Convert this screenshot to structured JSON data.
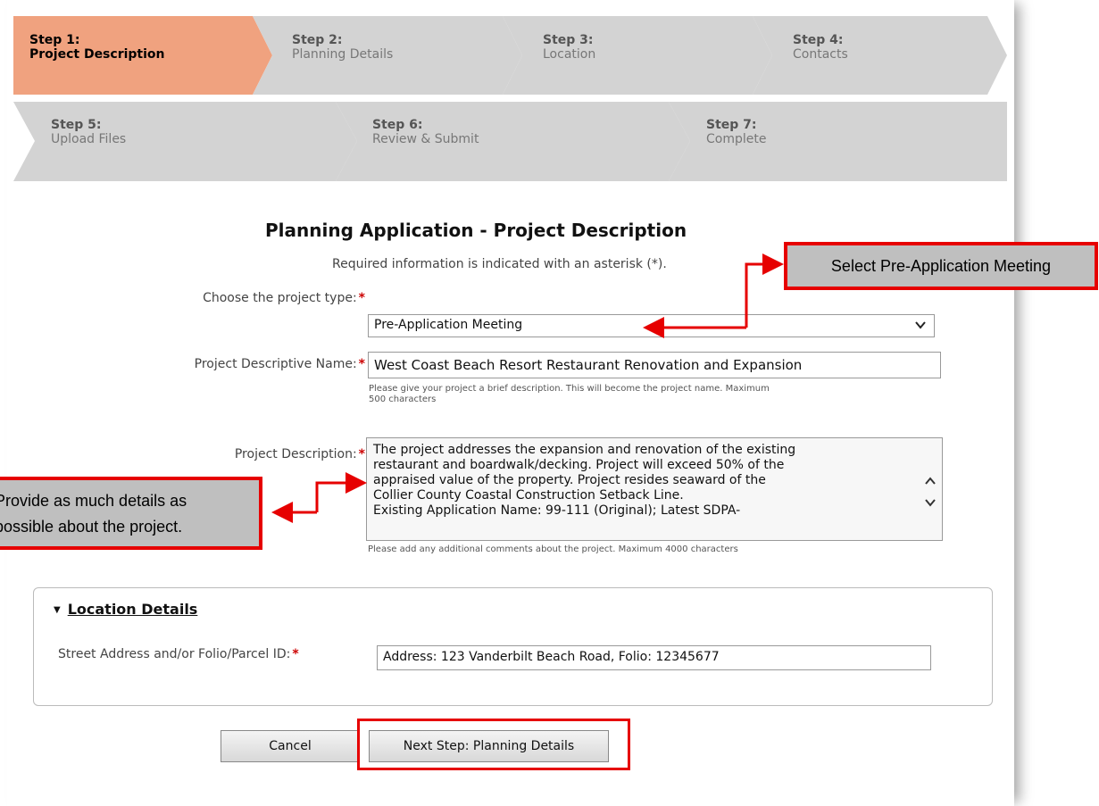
{
  "wizard": {
    "steps": [
      {
        "num": "Step 1:",
        "name": "Project Description",
        "active": true
      },
      {
        "num": "Step 2:",
        "name": "Planning Details",
        "active": false
      },
      {
        "num": "Step 3:",
        "name": "Location",
        "active": false
      },
      {
        "num": "Step 4:",
        "name": "Contacts",
        "active": false
      },
      {
        "num": "Step 5:",
        "name": "Upload Files",
        "active": false
      },
      {
        "num": "Step 6:",
        "name": "Review & Submit",
        "active": false
      },
      {
        "num": "Step 7:",
        "name": "Complete",
        "active": false
      }
    ],
    "colors": {
      "active": "#f0a27f",
      "inactive": "#d3d3d3"
    }
  },
  "page": {
    "title": "Planning Application - Project Description",
    "subtitle": "Required information is indicated with an asterisk (*)."
  },
  "form": {
    "project_type": {
      "label": "Choose the project type:",
      "value": "Pre-Application Meeting"
    },
    "project_name": {
      "label": "Project Descriptive Name:",
      "value": "West Coast Beach Resort Restaurant Renovation and Expansion",
      "hint_line1": "Please give your project a brief description. This will become the project name. Maximum",
      "hint_line2": "500 characters"
    },
    "project_description": {
      "label": "Project Description:",
      "lines": [
        "The project addresses the expansion and renovation of the existing",
        "restaurant and boardwalk/decking. Project will exceed 50% of the",
        "appraised value of the property. Project resides seaward of the",
        "Collier County Coastal Construction Setback Line.",
        "Existing Application Name: 99-111 (Original); Latest SDPA-"
      ],
      "hint": "Please add any additional comments about the project. Maximum 4000 characters"
    },
    "required_mark": "*"
  },
  "location": {
    "title": "Location Details",
    "address_label": "Street Address and/or Folio/Parcel ID:",
    "address_value": "Address: 123 Vanderbilt Beach Road, Folio: 12345677"
  },
  "buttons": {
    "cancel": "Cancel",
    "next": "Next Step: Planning Details"
  },
  "callouts": {
    "select": "Select Pre-Application Meeting",
    "details_line1": "Provide as much details as",
    "details_line2": "possible about the project.",
    "color": "#e60000"
  }
}
